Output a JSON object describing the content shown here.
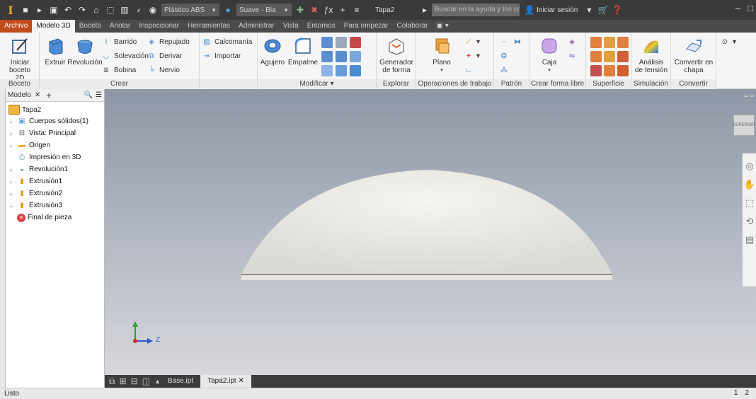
{
  "titlebar": {
    "material": "Plástico ABS",
    "appearance": "Suave - Bla",
    "fx": "ƒx",
    "doc_title": "Tapa2",
    "search_placeholder": "Buscar en la ayuda y los comandos",
    "signin": "Iniciar sesión"
  },
  "tabs": [
    "Archivo",
    "Modelo 3D",
    "Boceto",
    "Anotar",
    "Inspeccionar",
    "Herramientas",
    "Administrar",
    "Vista",
    "Entornos",
    "Para empezar",
    "Colaborar"
  ],
  "ribbon": {
    "boceto": {
      "start": "Iniciar",
      "start2": "boceto 2D",
      "label": "Boceto"
    },
    "crear": {
      "extruir": "Extruir",
      "revolucion": "Revolución",
      "barrido": "Barrido",
      "solevacion": "Solevación",
      "bobina": "Bobina",
      "repujado": "Repujado",
      "derivar": "Derivar",
      "nervio": "Nervio",
      "calcomania": "Calcomanía",
      "importar": "Importar",
      "label": "Crear"
    },
    "modificar": {
      "agujero": "Agujero",
      "empalme": "Empalme",
      "label": "Modificar ▾"
    },
    "explorar": {
      "gen": "Generador",
      "gen2": "de forma",
      "label": "Explorar"
    },
    "operaciones": {
      "plano": "Plano",
      "label": "Operaciones de trabajo"
    },
    "patron": {
      "label": "Patrón"
    },
    "forma_libre": {
      "caja": "Caja",
      "label": "Crear forma libre"
    },
    "superficie": {
      "label": "Superficie"
    },
    "simulacion": {
      "a1": "Análisis",
      "a2": "de tensión",
      "label": "Simulación"
    },
    "convertir": {
      "c1": "Convertir en",
      "c2": "chapa",
      "label": "Convertir"
    }
  },
  "browser": {
    "title": "Modelo",
    "root": "Tapa2",
    "items": [
      "Cuerpos sólidos(1)",
      "Vista: Principal",
      "Origen",
      "Impresión en 3D",
      "Revolución1",
      "Extrusión1",
      "Extrusión2",
      "Extrusión3",
      "Final de pieza"
    ]
  },
  "viewport": {
    "viewcube": "SUPERIOR",
    "axis_label": "Z"
  },
  "doctabs": [
    "Base.ipt",
    "Tapa2.ipt"
  ],
  "status": {
    "text": "Listo",
    "pages": [
      "1",
      "2"
    ]
  },
  "colors": {
    "accent_file_tab": "#c14b1a",
    "titlebar": "#3a3a3a",
    "ribbon": "#f5f5f5"
  }
}
